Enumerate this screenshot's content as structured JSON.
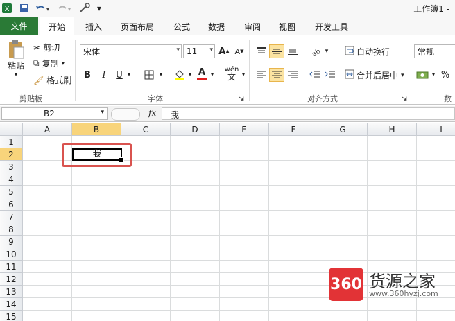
{
  "title_bar": {
    "doc_title": "工作簿1 -",
    "save_icon": "save-icon",
    "undo_icon": "undo-icon",
    "redo_icon": "redo-icon"
  },
  "tabs": [
    {
      "label": "文件"
    },
    {
      "label": "开始"
    },
    {
      "label": "插入"
    },
    {
      "label": "页面布局"
    },
    {
      "label": "公式"
    },
    {
      "label": "数据"
    },
    {
      "label": "审阅"
    },
    {
      "label": "视图"
    },
    {
      "label": "开发工具"
    }
  ],
  "clipboard": {
    "paste": "粘贴",
    "cut": "剪切",
    "copy": "复制",
    "format_painter": "格式刷",
    "group": "剪贴板"
  },
  "font": {
    "name": "宋体",
    "size": "11",
    "group": "字体",
    "bold": "B",
    "italic": "I",
    "underline": "U",
    "color_a": "A",
    "wen": "wén"
  },
  "alignment": {
    "wrap": "自动换行",
    "merge": "合并后居中",
    "group": "对齐方式"
  },
  "number": {
    "format": "常规",
    "percent": "%",
    "group": "数"
  },
  "formula_bar": {
    "name_box": "B2",
    "fx": "fx",
    "content": "我"
  },
  "sheet": {
    "columns": [
      "A",
      "B",
      "C",
      "D",
      "E",
      "F",
      "G",
      "H",
      "I"
    ],
    "rows": [
      "1",
      "2",
      "3",
      "4",
      "5",
      "6",
      "7",
      "8",
      "9",
      "10",
      "11",
      "12",
      "13",
      "14",
      "15"
    ],
    "selected_cell": "B2",
    "cell_b2_value": "我"
  },
  "watermark": {
    "logo": "360",
    "name": "货源之家",
    "url": "www.360hyzj.com"
  },
  "colors": {
    "file_tab": "#2a7a36",
    "selected_header": "#f8d47b",
    "highlight_box": "#d9534f"
  }
}
